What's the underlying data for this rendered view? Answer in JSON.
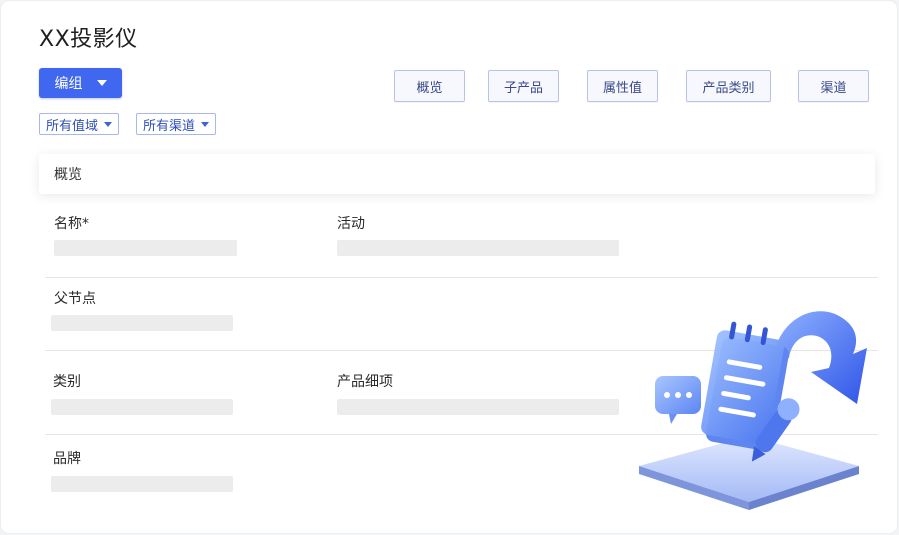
{
  "page": {
    "title": "XX投影仪",
    "edit_button": "编组"
  },
  "tabs": [
    {
      "label": "概览"
    },
    {
      "label": "子产品"
    },
    {
      "label": "属性值"
    },
    {
      "label": "产品类别"
    },
    {
      "label": "渠道"
    }
  ],
  "filters": [
    {
      "label": "所有值域"
    },
    {
      "label": "所有渠道"
    }
  ],
  "section": {
    "title": "概览"
  },
  "fields": {
    "name": "名称*",
    "activity": "活动",
    "parent_node": "父节点",
    "category": "类别",
    "product_detail": "产品细项",
    "brand": "品牌"
  },
  "colors": {
    "primary": "#3f67f0",
    "tab_border": "#b9c3e6",
    "filter_text": "#2f4fb8",
    "placeholder": "#ececec"
  },
  "icons": {
    "edit_dropdown": "caret-down-icon",
    "filter_dropdown": "caret-down-icon",
    "illustration": "notebook-pen-arrow-illustration"
  }
}
